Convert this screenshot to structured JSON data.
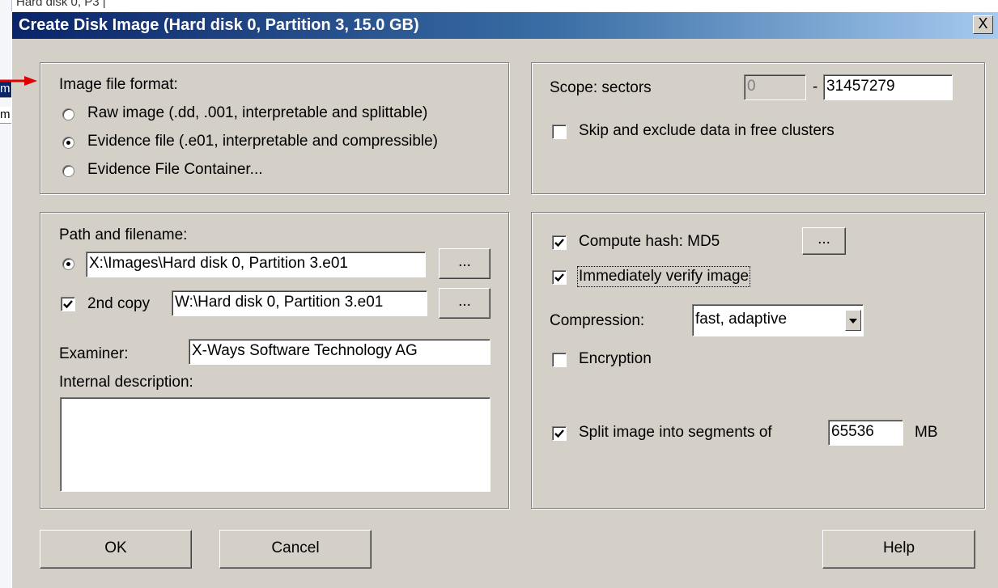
{
  "background": {
    "top_fragment": "Hard disk 0, P3 |",
    "left_fragment_1": "m",
    "left_fragment_2": "m"
  },
  "dialog": {
    "title": "Create Disk Image (Hard disk 0, Partition 3, 15.0 GB)",
    "close_label": "X"
  },
  "image_format": {
    "heading": "Image file format:",
    "options": [
      {
        "label": "Raw image (.dd, .001, interpretable and splittable)",
        "selected": false
      },
      {
        "label": "Evidence file (.e01, interpretable and compressible)",
        "selected": true
      },
      {
        "label": "Evidence File Container...",
        "selected": false
      }
    ]
  },
  "scope": {
    "label": "Scope: sectors",
    "from": "0",
    "dash": "-",
    "to": "31457279",
    "skip_label": "Skip and exclude data in free clusters",
    "skip_checked": false
  },
  "path": {
    "heading": "Path and filename:",
    "primary_path": "X:\\Images\\Hard disk 0, Partition 3.e01",
    "browse_label": "...",
    "second_copy_label": "2nd copy",
    "second_copy_checked": true,
    "second_copy_path": "W:\\Hard disk 0, Partition 3.e01",
    "browse2_label": "...",
    "examiner_label": "Examiner:",
    "examiner_value": "X-Ways Software Technology AG",
    "description_label": "Internal description:",
    "description_value": ""
  },
  "options": {
    "hash_label": "Compute hash: MD5",
    "hash_checked": true,
    "hash_button_label": "...",
    "verify_label": "Immediately verify image",
    "verify_checked": true,
    "compression_label": "Compression:",
    "compression_value": "fast, adaptive",
    "encryption_label": "Encryption",
    "encryption_checked": false,
    "split_label": "Split image into segments of",
    "split_checked": true,
    "split_value": "65536",
    "split_unit": "MB"
  },
  "buttons": {
    "ok": "OK",
    "cancel": "Cancel",
    "help": "Help"
  },
  "colors": {
    "dialog_bg": "#d4d0c8",
    "title_start": "#0a246a",
    "title_end": "#a6caf0",
    "arrow": "#e00000"
  }
}
